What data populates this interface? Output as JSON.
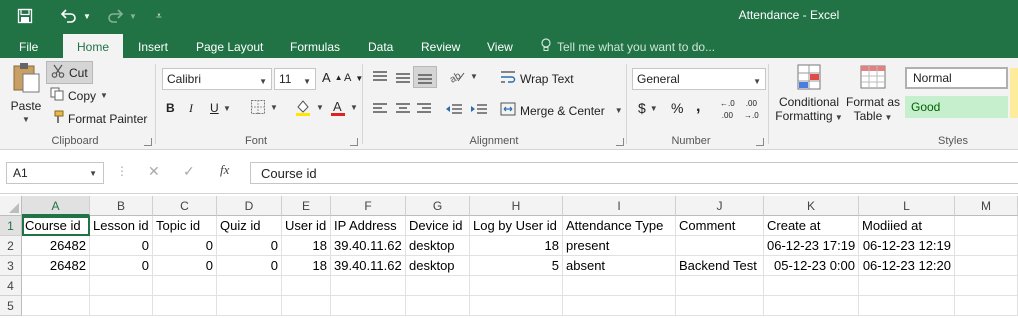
{
  "window": {
    "title": "Attendance - Excel"
  },
  "quick_access": {
    "save_icon": "save-icon",
    "undo_icon": "undo-icon",
    "redo_icon": "redo-icon",
    "customize_icon": "customize-icon"
  },
  "tabs": [
    {
      "label": "File"
    },
    {
      "label": "Home"
    },
    {
      "label": "Insert"
    },
    {
      "label": "Page Layout"
    },
    {
      "label": "Formulas"
    },
    {
      "label": "Data"
    },
    {
      "label": "Review"
    },
    {
      "label": "View"
    }
  ],
  "tell_me": "Tell me what you want to do...",
  "clipboard": {
    "paste": "Paste",
    "cut": "Cut",
    "copy": "Copy",
    "format_painter": "Format Painter",
    "group": "Clipboard"
  },
  "font": {
    "name": "Calibri",
    "size": "11",
    "bold": "B",
    "italic": "I",
    "underline": "U",
    "group": "Font"
  },
  "alignment": {
    "wrap_text": "Wrap Text",
    "merge_center": "Merge & Center",
    "group": "Alignment"
  },
  "number": {
    "format": "General",
    "currency": "$",
    "percent": "%",
    "comma": ",",
    "group": "Number"
  },
  "styles": {
    "conditional_1": "Conditional",
    "conditional_2": "Formatting",
    "table_1": "Format as",
    "table_2": "Table",
    "normal": "Normal",
    "good": "Good",
    "group": "Styles"
  },
  "formula_bar": {
    "name_box": "A1",
    "fx": "fx",
    "content": "Course id"
  },
  "columns": [
    "A",
    "B",
    "C",
    "D",
    "E",
    "F",
    "G",
    "H",
    "I",
    "J",
    "K",
    "L",
    "M"
  ],
  "rows": [
    "1",
    "2",
    "3",
    "4",
    "5"
  ],
  "table": {
    "header": [
      "Course id",
      "Lesson id",
      "Topic id",
      "Quiz id",
      "User id",
      "IP Address",
      "Device id",
      "Log by User id",
      "Attendance Type",
      "Comment",
      "Create at",
      "Modiied at"
    ],
    "data": [
      [
        "26482",
        "0",
        "0",
        "0",
        "18",
        "39.40.11.62",
        "desktop",
        "18",
        "present",
        "",
        "06-12-23 17:19",
        "06-12-23 12:19"
      ],
      [
        "26482",
        "0",
        "0",
        "0",
        "18",
        "39.40.11.62",
        "desktop",
        "5",
        "absent",
        "Backend Test",
        "05-12-23 0:00",
        "06-12-23 12:20"
      ]
    ]
  }
}
